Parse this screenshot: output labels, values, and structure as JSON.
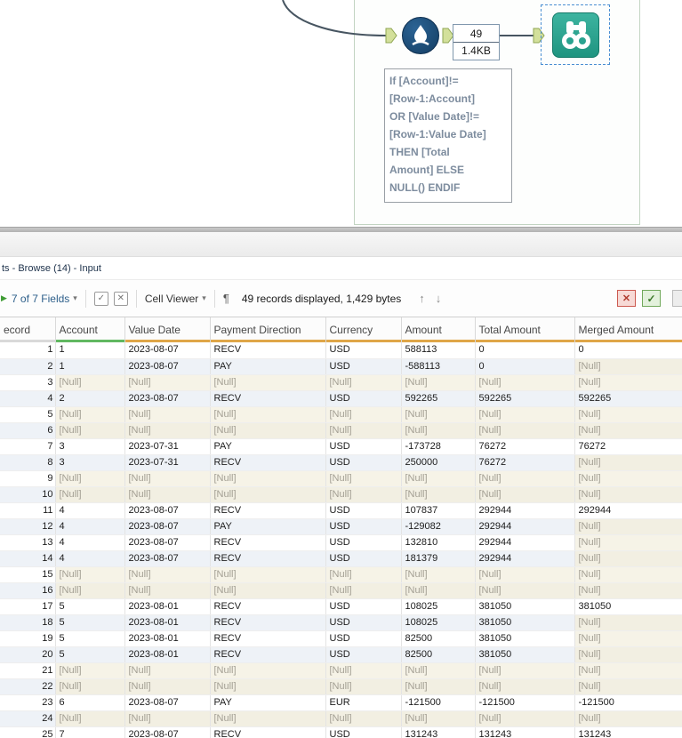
{
  "canvas": {
    "connection_count": "49",
    "connection_size": "1.4KB",
    "annotation_text": "If [Account]!= [Row-1:Account] OR [Value Date]!= [Row-1:Value Date] THEN [Total Amount] ELSE NULL() ENDIF",
    "colors": {
      "formula_tool": "#15466e",
      "browse_tool": "#2aa390",
      "anchor_fill": "#d3e09b",
      "anchor_border": "#8fa653",
      "selection_dash": "#4a8fd2",
      "wire": "#475561"
    }
  },
  "results": {
    "breadcrumb": "ts - Browse (14) - Input",
    "toolbar": {
      "fields_label": "7 of 7 Fields",
      "cell_viewer_label": "Cell Viewer",
      "status_text": "49 records displayed, 1,429 bytes"
    },
    "icons": {
      "collapse_arrow": "▶",
      "dropdown_caret": "▾",
      "select_check": "✓",
      "clear_x": "✕",
      "pilcrow": "¶",
      "up_arrow": "↑",
      "down_arrow": "↓",
      "cancel_x": "✕",
      "ok_check": "✓"
    },
    "action_colors": {
      "cancel": "#cc5a50",
      "ok": "#71a85b"
    }
  },
  "table": {
    "null_text": "[Null]",
    "columns": [
      {
        "label": "ecord",
        "bar": "#d9d9d9"
      },
      {
        "label": "Account",
        "bar": "#61b861"
      },
      {
        "label": "Value Date",
        "bar": "#dfa648"
      },
      {
        "label": "Payment Direction",
        "bar": "#dfa648"
      },
      {
        "label": "Currency",
        "bar": "#dfa648"
      },
      {
        "label": "Amount",
        "bar": "#dfa648"
      },
      {
        "label": "Total Amount",
        "bar": "#dfa648"
      },
      {
        "label": "Merged Amount",
        "bar": "#dfa648"
      }
    ],
    "rows": [
      [
        "1",
        "1",
        "2023-08-07",
        "RECV",
        "USD",
        "588113",
        "0",
        "0"
      ],
      [
        "2",
        "1",
        "2023-08-07",
        "PAY",
        "USD",
        "-588113",
        "0",
        "[Null]"
      ],
      [
        "3",
        "[Null]",
        "[Null]",
        "[Null]",
        "[Null]",
        "[Null]",
        "[Null]",
        "[Null]"
      ],
      [
        "4",
        "2",
        "2023-08-07",
        "RECV",
        "USD",
        "592265",
        "592265",
        "592265"
      ],
      [
        "5",
        "[Null]",
        "[Null]",
        "[Null]",
        "[Null]",
        "[Null]",
        "[Null]",
        "[Null]"
      ],
      [
        "6",
        "[Null]",
        "[Null]",
        "[Null]",
        "[Null]",
        "[Null]",
        "[Null]",
        "[Null]"
      ],
      [
        "7",
        "3",
        "2023-07-31",
        "PAY",
        "USD",
        "-173728",
        "76272",
        "76272"
      ],
      [
        "8",
        "3",
        "2023-07-31",
        "RECV",
        "USD",
        "250000",
        "76272",
        "[Null]"
      ],
      [
        "9",
        "[Null]",
        "[Null]",
        "[Null]",
        "[Null]",
        "[Null]",
        "[Null]",
        "[Null]"
      ],
      [
        "10",
        "[Null]",
        "[Null]",
        "[Null]",
        "[Null]",
        "[Null]",
        "[Null]",
        "[Null]"
      ],
      [
        "11",
        "4",
        "2023-08-07",
        "RECV",
        "USD",
        "107837",
        "292944",
        "292944"
      ],
      [
        "12",
        "4",
        "2023-08-07",
        "PAY",
        "USD",
        "-129082",
        "292944",
        "[Null]"
      ],
      [
        "13",
        "4",
        "2023-08-07",
        "RECV",
        "USD",
        "132810",
        "292944",
        "[Null]"
      ],
      [
        "14",
        "4",
        "2023-08-07",
        "RECV",
        "USD",
        "181379",
        "292944",
        "[Null]"
      ],
      [
        "15",
        "[Null]",
        "[Null]",
        "[Null]",
        "[Null]",
        "[Null]",
        "[Null]",
        "[Null]"
      ],
      [
        "16",
        "[Null]",
        "[Null]",
        "[Null]",
        "[Null]",
        "[Null]",
        "[Null]",
        "[Null]"
      ],
      [
        "17",
        "5",
        "2023-08-01",
        "RECV",
        "USD",
        "108025",
        "381050",
        "381050"
      ],
      [
        "18",
        "5",
        "2023-08-01",
        "RECV",
        "USD",
        "108025",
        "381050",
        "[Null]"
      ],
      [
        "19",
        "5",
        "2023-08-01",
        "RECV",
        "USD",
        "82500",
        "381050",
        "[Null]"
      ],
      [
        "20",
        "5",
        "2023-08-01",
        "RECV",
        "USD",
        "82500",
        "381050",
        "[Null]"
      ],
      [
        "21",
        "[Null]",
        "[Null]",
        "[Null]",
        "[Null]",
        "[Null]",
        "[Null]",
        "[Null]"
      ],
      [
        "22",
        "[Null]",
        "[Null]",
        "[Null]",
        "[Null]",
        "[Null]",
        "[Null]",
        "[Null]"
      ],
      [
        "23",
        "6",
        "2023-08-07",
        "PAY",
        "EUR",
        "-121500",
        "-121500",
        "-121500"
      ],
      [
        "24",
        "[Null]",
        "[Null]",
        "[Null]",
        "[Null]",
        "[Null]",
        "[Null]",
        "[Null]"
      ],
      [
        "25",
        "7",
        "2023-08-07",
        "RECV",
        "USD",
        "131243",
        "131243",
        "131243"
      ]
    ]
  }
}
